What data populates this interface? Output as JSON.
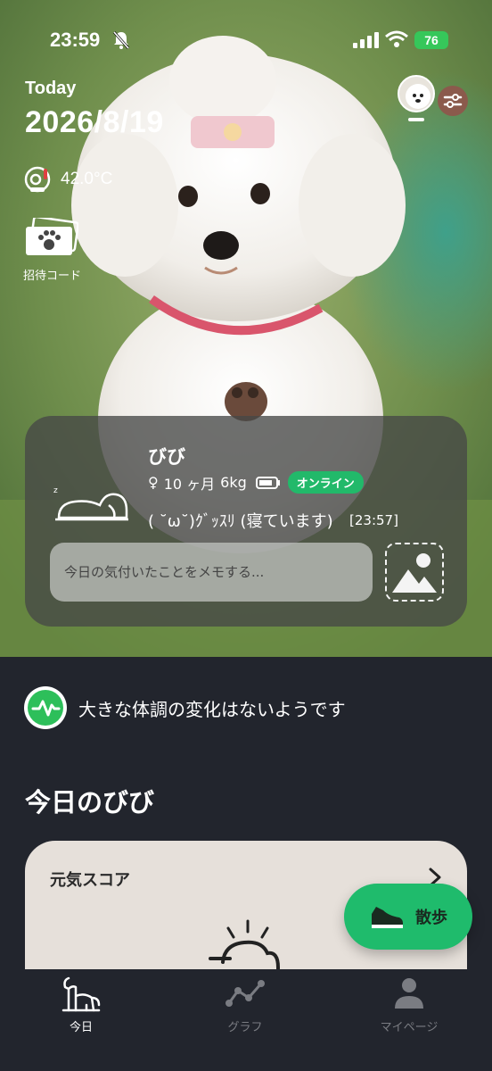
{
  "status_bar": {
    "time": "23:59",
    "battery": "76",
    "icons": [
      "bell-slash-icon",
      "signal-icon",
      "wifi-icon",
      "battery-icon"
    ]
  },
  "header": {
    "today_label": "Today",
    "date": "2026/8/19",
    "temperature": "42.0°C",
    "invite_label": "招待コード"
  },
  "pet": {
    "name": "びび",
    "sex_symbol": "♀",
    "age": "10 ヶ月",
    "weight": "6kg",
    "online_label": "オンライン",
    "status": "( ˘ω˘)ｸﾞｯｽﾘ (寝ています)",
    "status_time": "[23:57]",
    "memo_placeholder": "今日の気付いたことをメモする..."
  },
  "health": {
    "message": "大きな体調の変化はないようです"
  },
  "section": {
    "title": "今日のびび"
  },
  "genki_card": {
    "title": "元気スコア"
  },
  "walk_button": {
    "label": "散歩"
  },
  "tabs": [
    {
      "label": "今日",
      "icon": "dog-icon",
      "active": true
    },
    {
      "label": "グラフ",
      "icon": "graph-icon",
      "active": false
    },
    {
      "label": "マイページ",
      "icon": "person-icon",
      "active": false
    }
  ],
  "colors": {
    "accent_green": "#22b96a",
    "dark_bg": "#22252d",
    "card_light": "#e6e0da"
  }
}
